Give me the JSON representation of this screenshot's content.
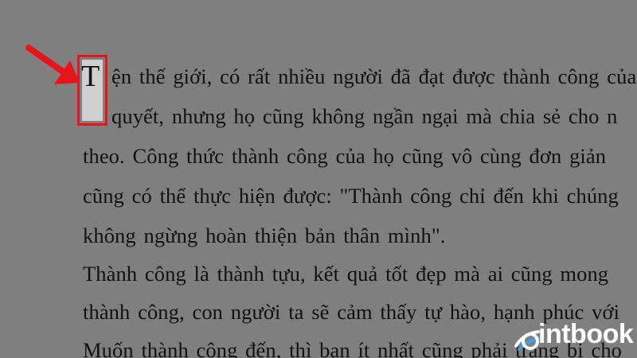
{
  "document": {
    "dropcap": "T",
    "lines": [
      "ện thế giới, có rất nhiều người đã đạt được thành công của",
      "quyết, nhưng họ cũng không ngần ngại mà chia sẻ cho n",
      "theo. Công thức thành công của họ cũng vô cùng đơn giản",
      "cũng có thể thực hiện được: \"Thành công chỉ đến khi chúng",
      "không ngừng hoàn thiện bản thân mình\".",
      "Thành công là thành tựu, kết quả tốt đẹp mà ai cũng mong",
      "thành công, con người ta sẽ cảm thấy tự hào, hạnh phúc với",
      "Muốn thành công đến, thì bạn ít nhất cũng phải trang bị cho"
    ]
  },
  "colors": {
    "background": "#7f7f7f",
    "highlight_border": "#e8141c",
    "dropcap_fill": "#cfcfcf",
    "arrow": "#e8141c",
    "watermark": "#ffffff"
  },
  "watermark": {
    "text_1": "i",
    "text_2": "ntbook",
    "icon": "book-icon"
  }
}
